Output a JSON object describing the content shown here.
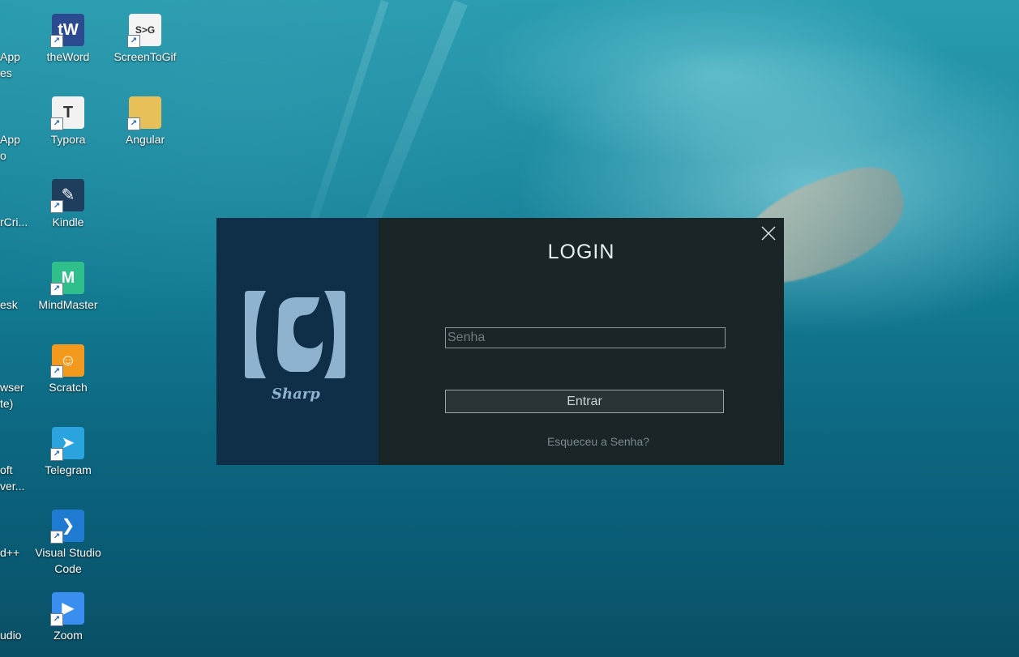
{
  "desktop": {
    "partial_left_labels": [
      "App",
      "es",
      "App",
      "o",
      "rCri...",
      "esk",
      "wser",
      "te)",
      "oft",
      "ver...",
      "d++",
      "udio"
    ],
    "col1": [
      {
        "label": "theWord",
        "icon": "theword-icon",
        "glyph": "tW",
        "color": "#2b4a8f"
      },
      {
        "label": "Typora",
        "icon": "typora-icon",
        "glyph": "T",
        "color": "#f2f2f2"
      },
      {
        "label": "Kindle",
        "icon": "kindle-icon",
        "glyph": "✎",
        "color": "#1f3d5c"
      },
      {
        "label": "MindMaster",
        "icon": "mindmaster-icon",
        "glyph": "M",
        "color": "#2fbf8a"
      },
      {
        "label": "Scratch",
        "icon": "scratch-icon",
        "glyph": "☺",
        "color": "#f39a1e"
      },
      {
        "label": "Telegram",
        "icon": "telegram-icon",
        "glyph": "➤",
        "color": "#2aa3df"
      },
      {
        "label": "Visual Studio Code",
        "icon": "vscode-icon",
        "glyph": "❯",
        "color": "#1f7ad1"
      },
      {
        "label": "Zoom",
        "icon": "zoom-icon",
        "glyph": "▶",
        "color": "#3a8ef0"
      }
    ],
    "col2": [
      {
        "label": "ScreenToGif",
        "icon": "screentogif-icon",
        "glyph": "S>G",
        "color": "#f4f4f4"
      },
      {
        "label": "Angular",
        "icon": "folder-icon",
        "glyph": "",
        "color": "#e8c05a"
      }
    ]
  },
  "dialog": {
    "title": "LOGIN",
    "brand_subtitle": "Sharp",
    "password_placeholder": "Senha",
    "password_value": "",
    "enter_label": "Entrar",
    "forgot_label": "Esqueceu a Senha?",
    "colors": {
      "brand_panel": "#0f2f49",
      "form_panel": "#1a2528",
      "logo": "#8fb3cf"
    }
  }
}
